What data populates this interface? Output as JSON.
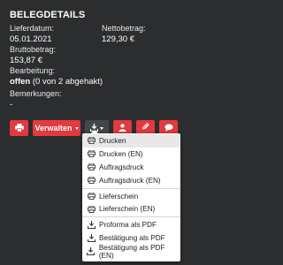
{
  "details": {
    "title": "BELEGDETAILS",
    "lieferdatum_label": "Lieferdatum:",
    "lieferdatum_value": "05.01.2021",
    "netto_label": "Nettobetrag:",
    "netto_value": "129,30 €",
    "brutto_label": "Bruttobetrag:",
    "brutto_value": "153,87 €",
    "bearbeitung_label": "Bearbeitung:",
    "bearbeitung_status": "offen",
    "bearbeitung_detail": "(0 von 2 abgehakt)",
    "bemerkungen_label": "Bemerkungen:",
    "bemerkungen_value": "-"
  },
  "toolbar": {
    "verwalten_label": "Verwalten",
    "accent_color": "#e23a3e",
    "icons": [
      "printer-icon",
      "download-icon",
      "user-icon",
      "paperclip-icon",
      "comment-icon"
    ]
  },
  "menu": {
    "items": [
      {
        "label": "Drucken",
        "icon": "printer-icon"
      },
      {
        "label": "Drucken (EN)",
        "icon": "printer-icon"
      },
      {
        "label": "Auftragsdruck",
        "icon": "printer-icon"
      },
      {
        "label": "Auftragsdruck (EN)",
        "icon": "printer-icon"
      },
      {
        "label": "Lieferschein",
        "icon": "printer-icon"
      },
      {
        "label": "Lieferschein (EN)",
        "icon": "printer-icon"
      },
      {
        "label": "Proforma als PDF",
        "icon": "download-icon"
      },
      {
        "label": "Bestätigung als PDF",
        "icon": "download-icon"
      },
      {
        "label": "Bestätigung als PDF (EN)",
        "icon": "download-icon"
      }
    ]
  }
}
